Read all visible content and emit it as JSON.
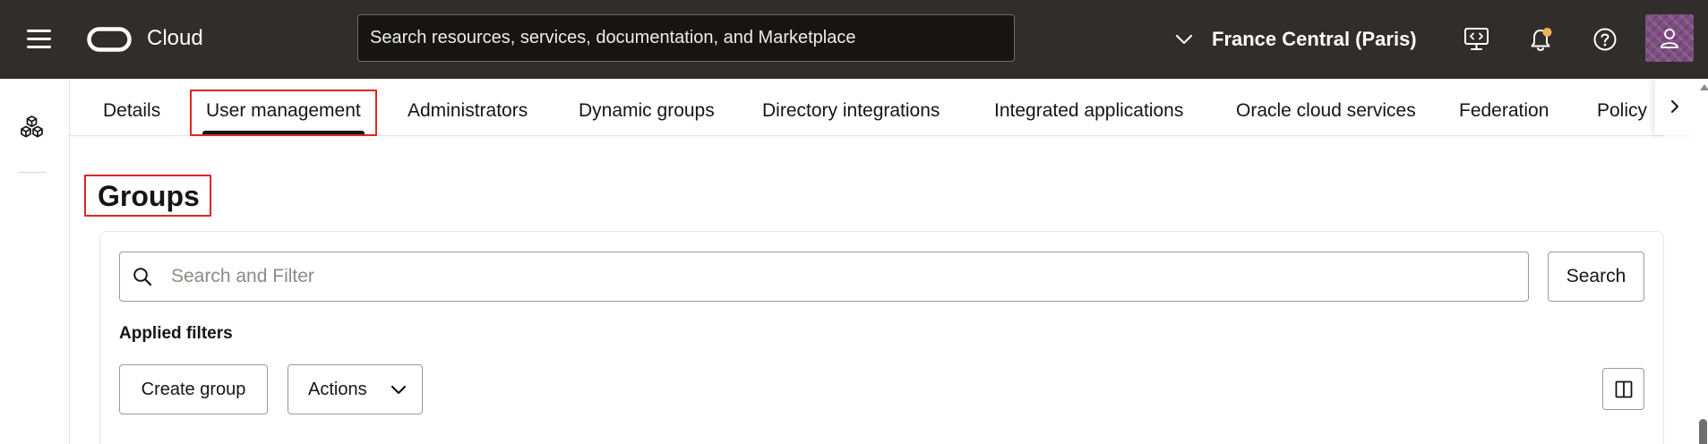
{
  "topbar": {
    "brand_text": "Cloud",
    "search": {
      "placeholder": "Search resources, services, documentation, and Marketplace"
    },
    "region": "France Central (Paris)",
    "notifications": {
      "has_unread": true
    }
  },
  "tabs": [
    {
      "label": "Details"
    },
    {
      "label": "User management",
      "active": true
    },
    {
      "label": "Administrators"
    },
    {
      "label": "Dynamic groups"
    },
    {
      "label": "Directory integrations"
    },
    {
      "label": "Integrated applications"
    },
    {
      "label": "Oracle cloud services"
    },
    {
      "label": "Federation"
    },
    {
      "label": "Policy"
    }
  ],
  "page": {
    "title": "Groups"
  },
  "filter": {
    "placeholder": "Search and Filter",
    "search_button": "Search",
    "applied_filters": "Applied filters"
  },
  "toolbar": {
    "create_group": "Create group",
    "actions": "Actions"
  },
  "icons": {
    "menu": "hamburger-icon",
    "logo": "oracle-logo-icon",
    "region": "chevron-down-icon",
    "cloud_shell": "cloud-shell-icon",
    "notifications": "bell-icon",
    "help": "help-icon",
    "profile": "user-icon",
    "rail": "cubes-icon",
    "tabs_next": "chevron-right-icon",
    "filter": "search-icon",
    "columns": "columns-icon"
  },
  "colors": {
    "topbar": "#312D2A",
    "highlight": "#E02424",
    "notification_dot": "#F0B256",
    "avatar": "#7E4E80",
    "text": "#161513"
  }
}
